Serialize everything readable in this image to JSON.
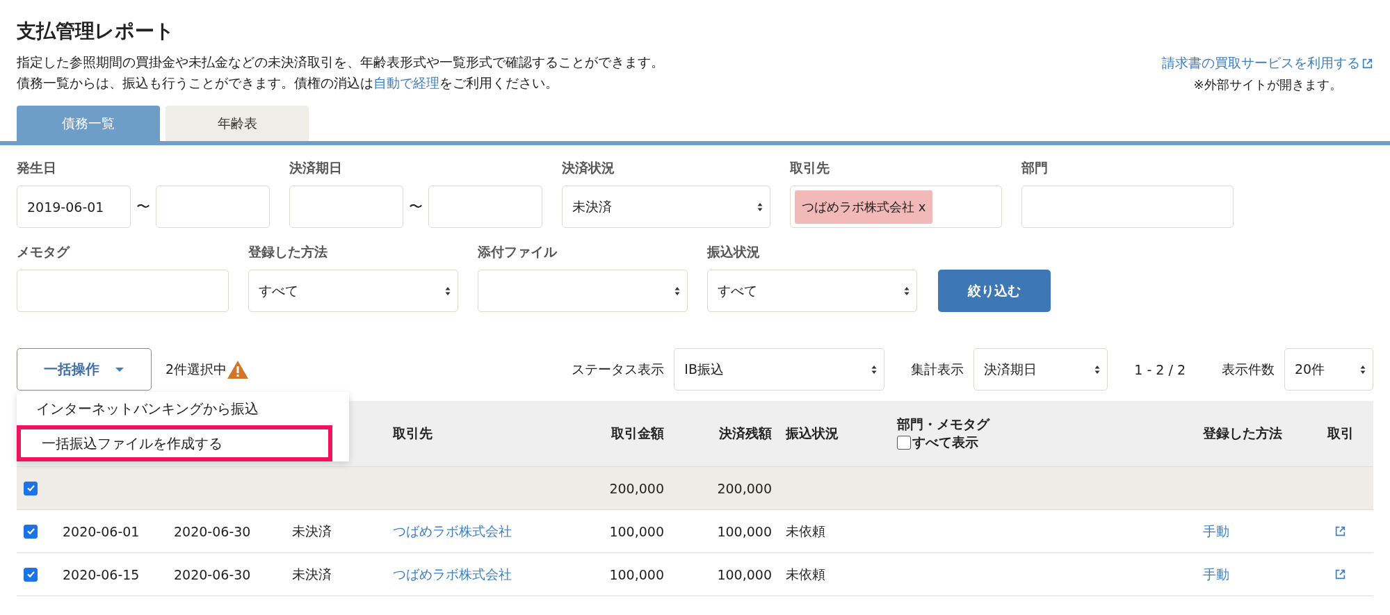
{
  "page": {
    "title": "支払管理レポート",
    "description": "指定した参照期間の買掛金や未払金などの未決済取引を、年齢表形式や一覧形式で確認することができます。",
    "description_2": {
      "before": "債務一覧からは、振込も行うことができます。債権の消込は",
      "link": "自動で経理",
      "after": "をご利用ください。"
    },
    "external_link": "請求書の買取サービスを利用する",
    "external_note": "※外部サイトが開きます。"
  },
  "tabs": [
    {
      "label": "債務一覧",
      "selected": true
    },
    {
      "label": "年齢表",
      "selected": false
    }
  ],
  "filters": {
    "range_separator": "〜",
    "issue_date": {
      "label": "発生日",
      "from": "2019-06-01"
    },
    "due_date": {
      "label": "決済期日"
    },
    "settlement_status": {
      "label": "決済状況",
      "value": "未決済"
    },
    "partner": {
      "label": "取引先",
      "tag": "つばめラボ株式会社",
      "remove": "x"
    },
    "department": {
      "label": "部門"
    },
    "memo_tag": {
      "label": "メモタグ"
    },
    "registration_method": {
      "label": "登録した方法",
      "value": "すべて"
    },
    "attachment": {
      "label": "添付ファイル"
    },
    "transfer_status": {
      "label": "振込状況",
      "value": "すべて"
    },
    "submit": "絞り込む"
  },
  "toolbar": {
    "bulk_action": "一括操作",
    "selection_count": "2件選択中",
    "status_label": "ステータス表示",
    "status_value": "IB振込",
    "aggregate_label": "集計表示",
    "aggregate_value": "決済期日",
    "range": "1 - 2 / 2",
    "per_page_label": "表示件数",
    "per_page_value": "20件"
  },
  "bulk_menu": {
    "items": [
      {
        "label": "インターネットバンキングから振込",
        "selected": false
      },
      {
        "label": "一括振込ファイルを作成する",
        "selected": true
      }
    ]
  },
  "table": {
    "columns": [
      "",
      "",
      "",
      "",
      "取引先",
      "取引金額",
      "決済残額",
      "振込状況",
      "部門・メモタグ",
      "登録した方法",
      "取引"
    ],
    "show_all": {
      "label": "すべて表示",
      "checked": false
    },
    "group": {
      "checked": true,
      "amount": "200,000",
      "balance": "200,000"
    },
    "rows": [
      {
        "checked": true,
        "issue_date": "2020-06-01",
        "due_date": "2020-06-30",
        "status": "未決済",
        "partner": "つばめラボ株式会社",
        "amount": "100,000",
        "balance": "100,000",
        "transfer": "未依頼",
        "method": "手動"
      },
      {
        "checked": true,
        "issue_date": "2020-06-15",
        "due_date": "2020-06-30",
        "status": "未決済",
        "partner": "つばめラボ株式会社",
        "amount": "100,000",
        "balance": "100,000",
        "transfer": "未依頼",
        "method": "手動"
      }
    ]
  }
}
